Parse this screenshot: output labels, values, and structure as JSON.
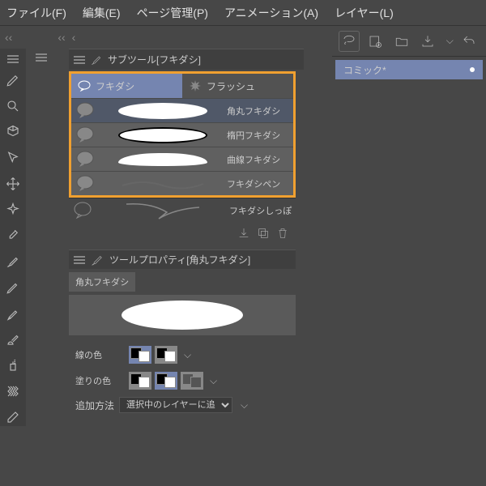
{
  "menu": {
    "file": "ファイル(F)",
    "edit": "編集(E)",
    "page": "ページ管理(P)",
    "anim": "アニメーション(A)",
    "layer": "レイヤー(L)"
  },
  "subtool": {
    "title": "サブツール[フキダシ]"
  },
  "tabs": {
    "balloon": "フキダシ",
    "flash": "フラッシュ"
  },
  "shapes": {
    "rounded": "角丸フキダシ",
    "ellipse": "楕円フキダシ",
    "curve": "曲線フキダシ",
    "pen": "フキダシペン",
    "tail": "フキダシしっぽ"
  },
  "props": {
    "title": "ツールプロパティ[角丸フキダシ]",
    "name": "角丸フキダシ",
    "lineColor": "線の色",
    "fillColor": "塗りの色",
    "addMethod": "追加方法",
    "addMethodValue": "選択中のレイヤーに追加"
  },
  "doc": {
    "name": "コミック*"
  },
  "colors": {
    "black": "#000",
    "white": "#fff"
  }
}
